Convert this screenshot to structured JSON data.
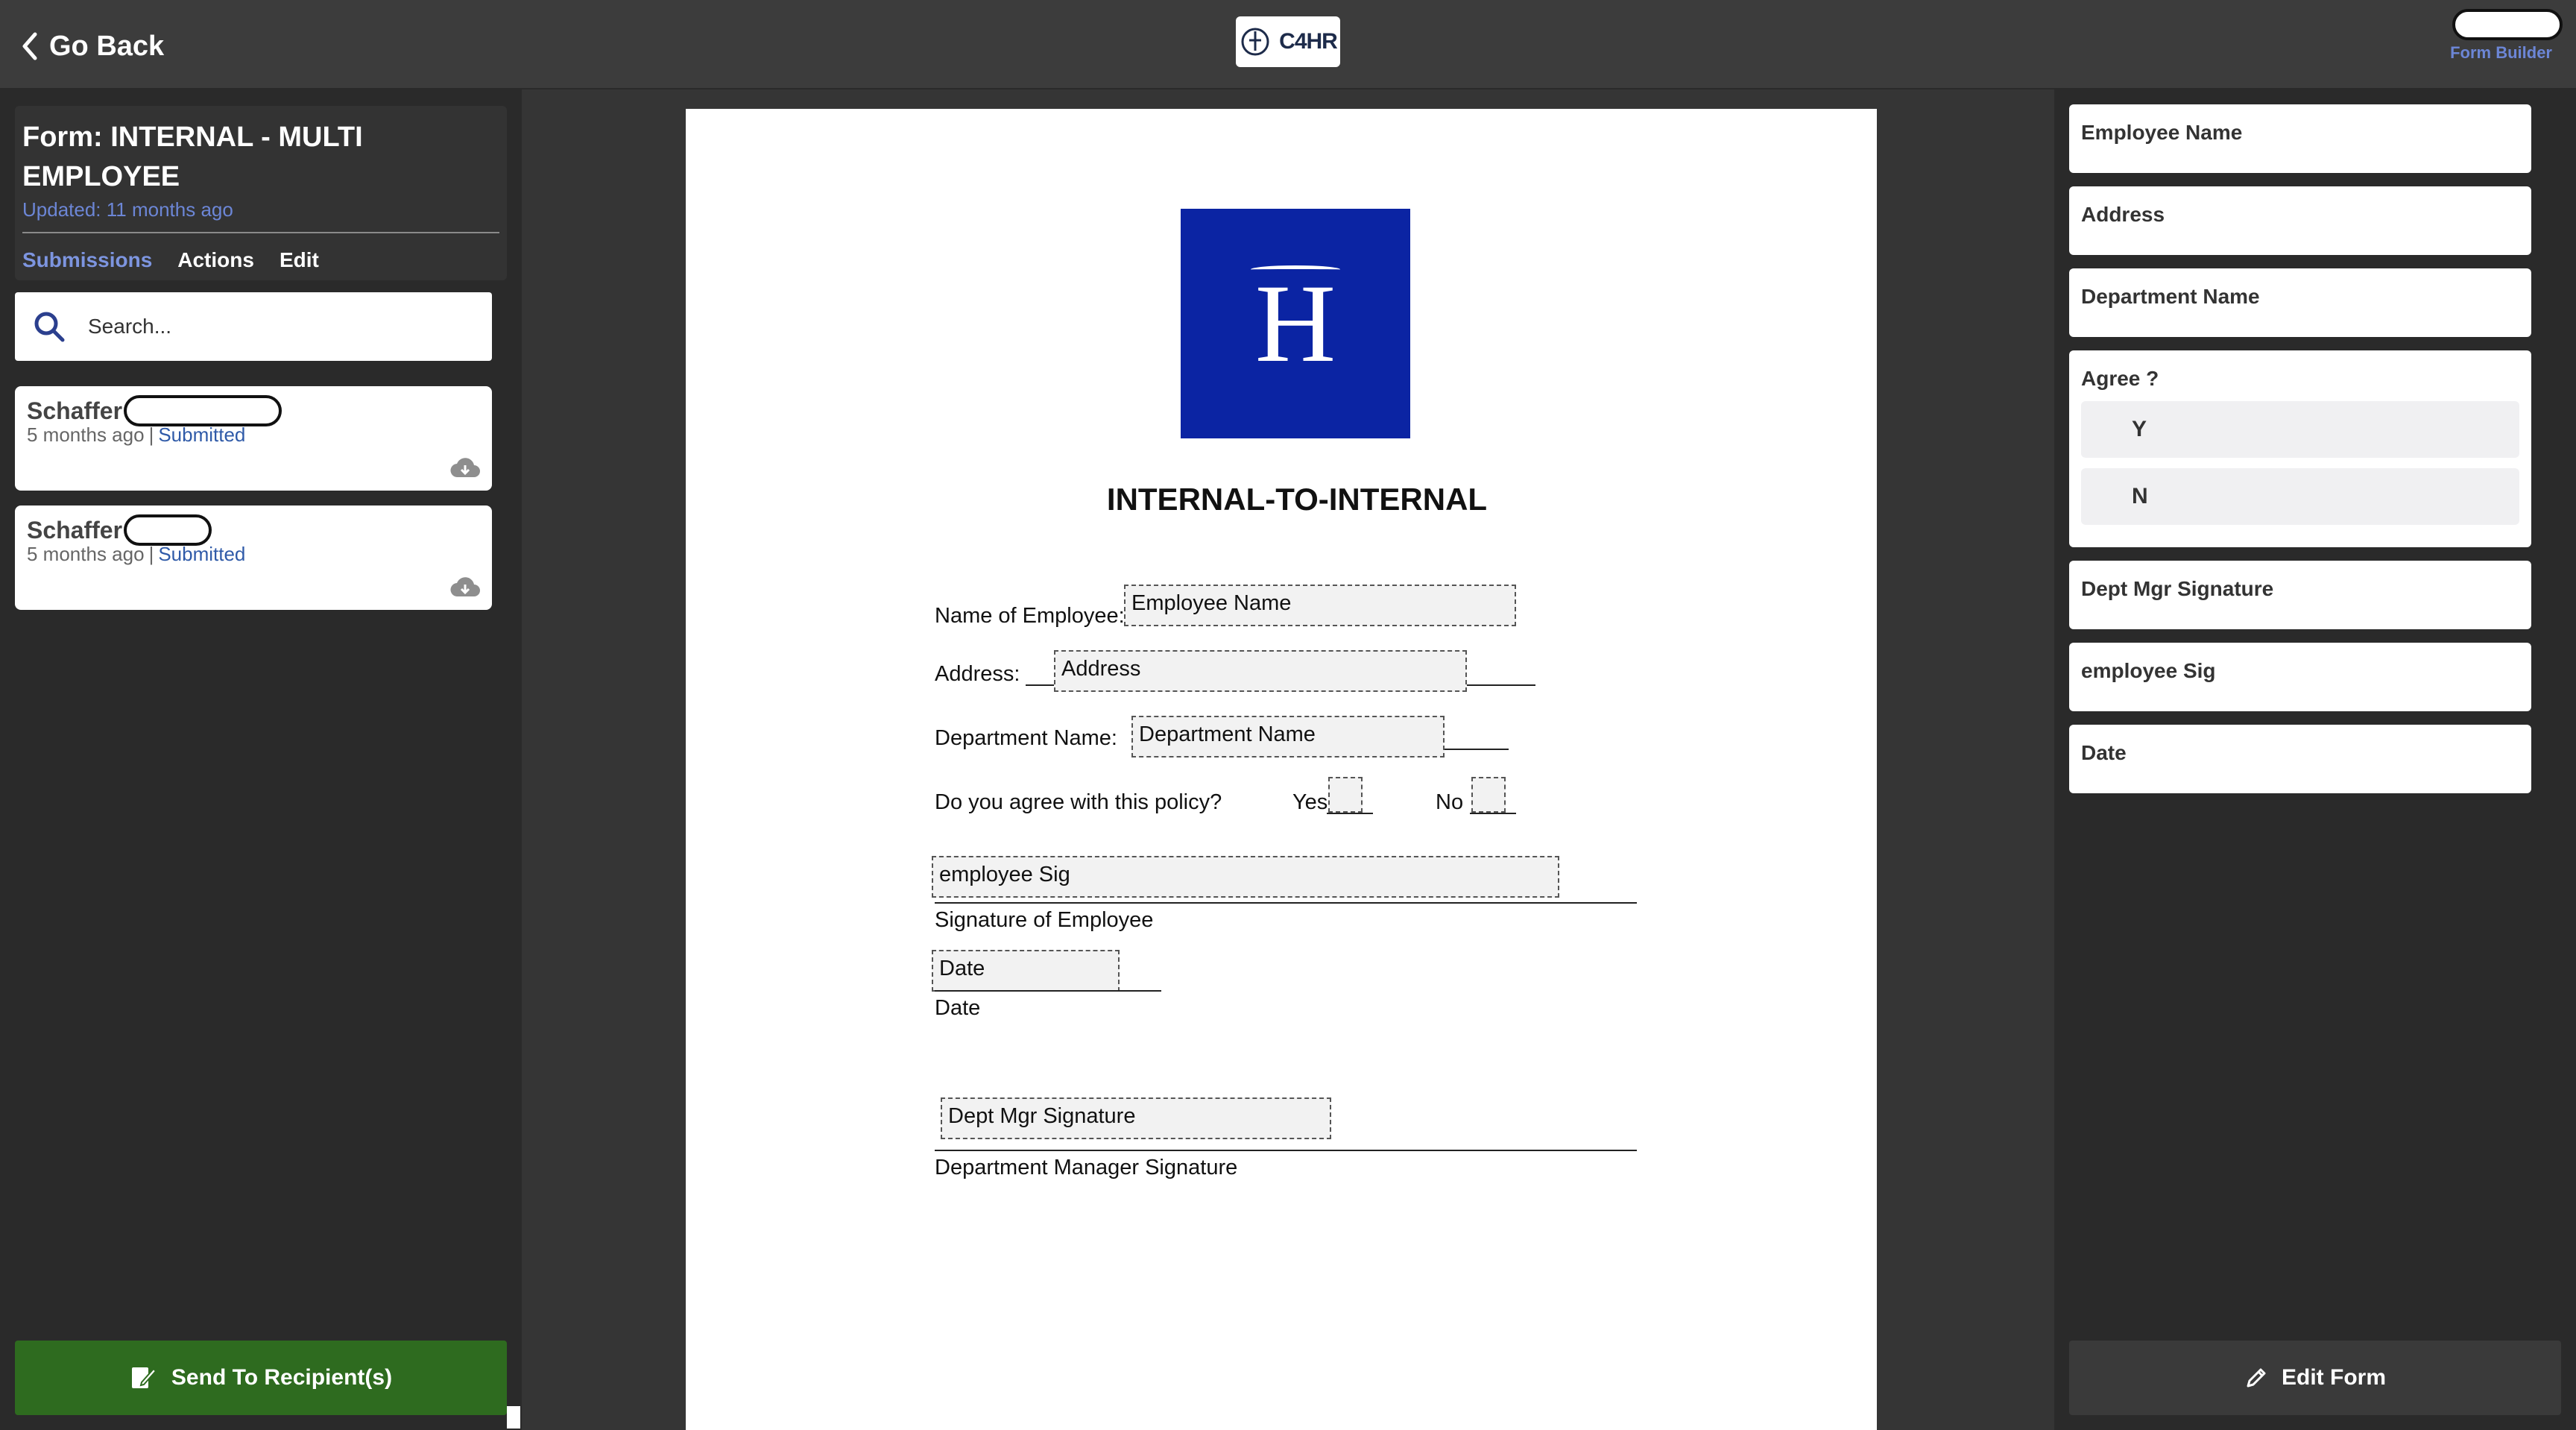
{
  "header": {
    "back_label": "Go Back",
    "brand_text": "C4HR",
    "builder_label": "Form Builder"
  },
  "form": {
    "title": "Form: INTERNAL - MULTI EMPLOYEE",
    "updated": "Updated: 11 months ago",
    "tabs": [
      "Submissions",
      "Actions",
      "Edit"
    ],
    "active_tab": "Submissions"
  },
  "search": {
    "placeholder": "Search..."
  },
  "submissions": [
    {
      "name": "Schaffer",
      "time": "5 months ago",
      "status": "Submitted"
    },
    {
      "name": "Schaffer",
      "time": "5 months ago",
      "status": "Submitted"
    }
  ],
  "send_button": "Send To Recipient(s)",
  "document": {
    "logo_letter": "H",
    "title": "INTERNAL-TO-INTERNAL",
    "labels": {
      "name": "Name of Employee:",
      "address": "Address:",
      "department": "Department Name:",
      "agree": "Do you agree with this policy?",
      "yes": "Yes",
      "no": "No",
      "sig_employee": "Signature of Employee",
      "date": "Date",
      "sig_manager": "Department Manager Signature"
    },
    "fields": {
      "employee_name": "Employee Name",
      "address": "Address",
      "department_name": "Department Name",
      "employee_sig": "employee Sig",
      "date": "Date",
      "dept_mgr_sig": "Dept Mgr Signature"
    }
  },
  "right_fields": {
    "employee_name": "Employee Name",
    "address": "Address",
    "department_name": "Department Name",
    "agree": "Agree ?",
    "agree_options": [
      "Y",
      "N"
    ],
    "dept_mgr_sig": "Dept Mgr Signature",
    "employee_sig": "employee Sig",
    "date": "Date"
  },
  "edit_button": "Edit Form",
  "colors": {
    "accent": "#7d95e0",
    "send_green": "#2e6b1f",
    "logo_blue": "#0b24a3"
  }
}
